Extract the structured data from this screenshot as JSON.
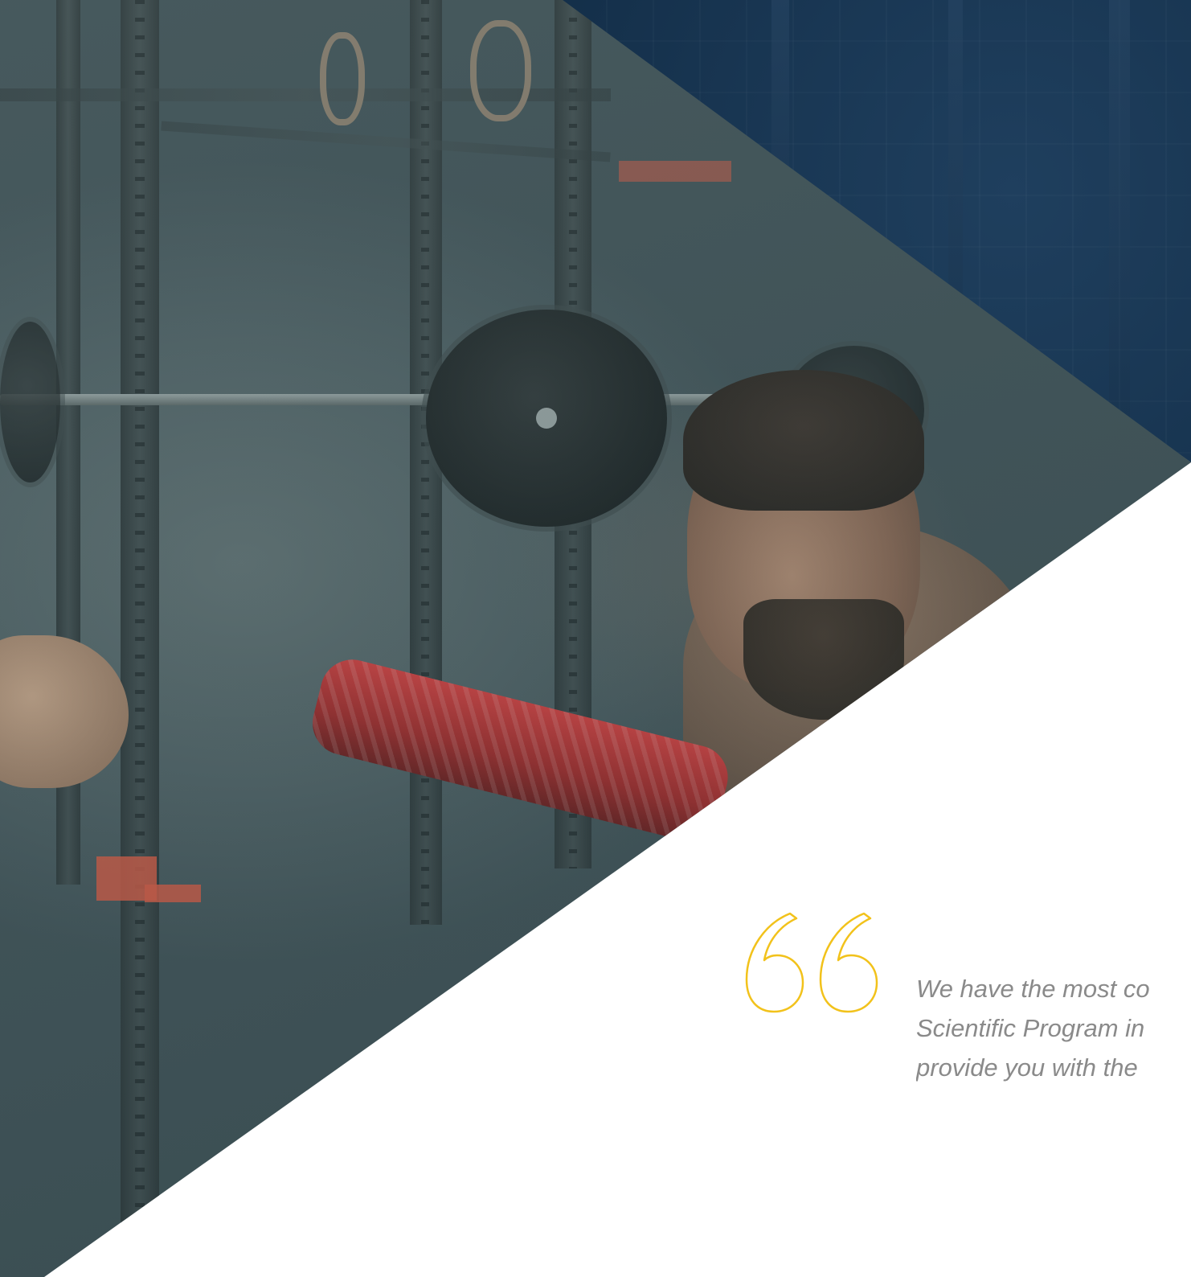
{
  "quote": {
    "icon": "quote-open-icon",
    "accent_color": "#f2c21b",
    "text_color": "#8a8a8a",
    "lines": [
      "We have the most co",
      "Scientific Program in",
      "provide you with the"
    ]
  },
  "colors": {
    "dark_panel": "#102a43",
    "background": "#ffffff"
  }
}
